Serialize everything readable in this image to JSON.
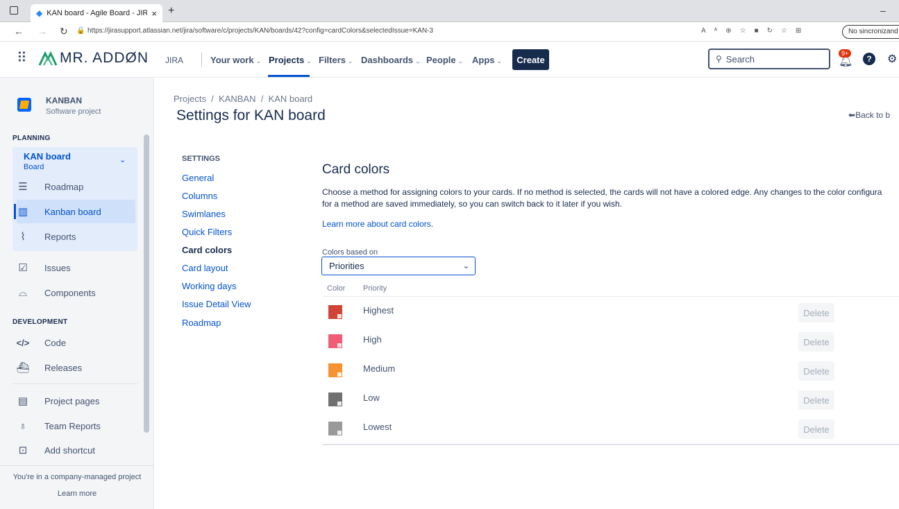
{
  "browser": {
    "tab_title": "KAN board - Agile Board - JIRA",
    "tab_close": "×",
    "new_tab": "+",
    "url": "https://jirasupport.atlassian.net/jira/software/c/projects/KAN/boards/42?config=cardColors&selectedIssue=KAN-3",
    "sync_label": "No sincronizand",
    "minimize": "–"
  },
  "topnav": {
    "logo_text": "MR. ADDØN",
    "product": "JIRA",
    "items": [
      "Your work",
      "Projects",
      "Filters",
      "Dashboards",
      "People",
      "Apps"
    ],
    "create_label": "Create",
    "search_placeholder": "Search",
    "notification_count": "9+",
    "help_label": "?"
  },
  "sidebar": {
    "project_name": "KANBAN",
    "project_type": "Software project",
    "planning_heading": "PLANNING",
    "board_name": "KAN board",
    "board_sub": "Board",
    "planning_items": [
      "Roadmap",
      "Kanban board",
      "Reports"
    ],
    "other_items": [
      "Issues",
      "Components"
    ],
    "development_heading": "DEVELOPMENT",
    "development_items": [
      "Code",
      "Releases"
    ],
    "bottom_items": [
      "Project pages",
      "Team Reports",
      "Add shortcut"
    ],
    "footer_text": "You're in a company-managed project",
    "footer_link": "Learn more"
  },
  "main": {
    "breadcrumb": "Projects  /  KANBAN  /  KAN board",
    "page_title": "Settings for KAN board",
    "back_link": "Back to b",
    "settings_heading": "SETTINGS",
    "settings_items": [
      "General",
      "Columns",
      "Swimlanes",
      "Quick Filters",
      "Card colors",
      "Card layout",
      "Working days",
      "Issue Detail View",
      "Roadmap"
    ],
    "section_title": "Card colors",
    "description_line1": "Choose a method for assigning colors to your cards. If no method is selected, the cards will not have a colored edge. Any changes to the color configura",
    "description_line2": "for a method are saved immediately, so you can switch back to it later if you wish.",
    "learn_more": "Learn more about card colors.",
    "colors_based_on_label": "Colors based on",
    "colors_based_on_value": "Priorities",
    "table_headers": {
      "color": "Color",
      "priority": "Priority"
    },
    "rows": [
      {
        "priority": "Highest",
        "color": "#d04437",
        "action": "Delete"
      },
      {
        "priority": "High",
        "color": "#f15c75",
        "action": "Delete"
      },
      {
        "priority": "Medium",
        "color": "#f79232",
        "action": "Delete"
      },
      {
        "priority": "Low",
        "color": "#707070",
        "action": "Delete"
      },
      {
        "priority": "Lowest",
        "color": "#999999",
        "action": "Delete"
      }
    ]
  },
  "colors": {
    "accent": "#0052cc",
    "create": "#172b4d",
    "sidebar_active": "#deebff",
    "notify": "#de350b"
  }
}
